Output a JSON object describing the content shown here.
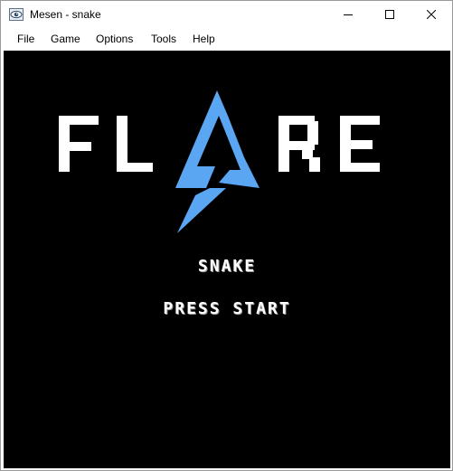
{
  "window": {
    "title": "Mesen - snake",
    "app_icon": "mesen-eye-icon"
  },
  "menubar": {
    "items": [
      "File",
      "Game",
      "Options",
      "Tools",
      "Help"
    ]
  },
  "game": {
    "logo_text": "FLARE",
    "logo_icon": "lightning-bolt-icon",
    "logo_accent_color": "#5aa6f2",
    "title": "SNAKE",
    "prompt": "PRESS START",
    "background_color": "#000000"
  }
}
